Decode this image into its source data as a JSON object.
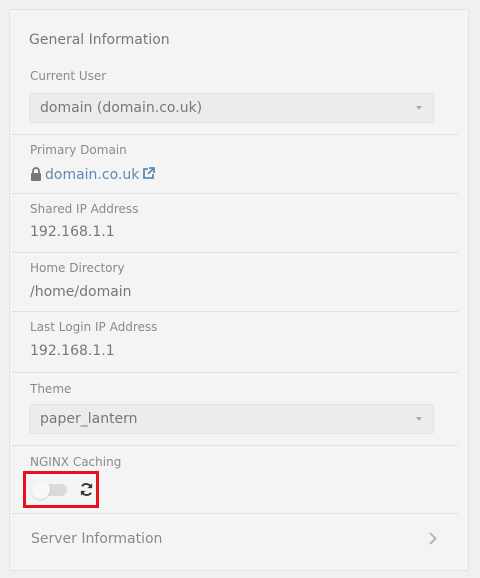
{
  "panel": {
    "title": "General Information"
  },
  "current_user": {
    "label": "Current User",
    "selected": "domain (domain.co.uk)"
  },
  "primary_domain": {
    "label": "Primary Domain",
    "value": "domain.co.uk"
  },
  "shared_ip": {
    "label": "Shared IP Address",
    "value": "192.168.1.1"
  },
  "home_directory": {
    "label": "Home Directory",
    "value": "/home/domain"
  },
  "last_login_ip": {
    "label": "Last Login IP Address",
    "value": "192.168.1.1"
  },
  "theme": {
    "label": "Theme",
    "selected": "paper_lantern"
  },
  "nginx_caching": {
    "label": "NGINX Caching",
    "enabled": false
  },
  "footer": {
    "label": "Server Information"
  },
  "colors": {
    "link": "#5d8ab4",
    "highlight": "#e5121b"
  },
  "icons": [
    "lock-icon",
    "external-link-icon",
    "chevron-down-icon",
    "refresh-icon",
    "chevron-right-icon"
  ]
}
